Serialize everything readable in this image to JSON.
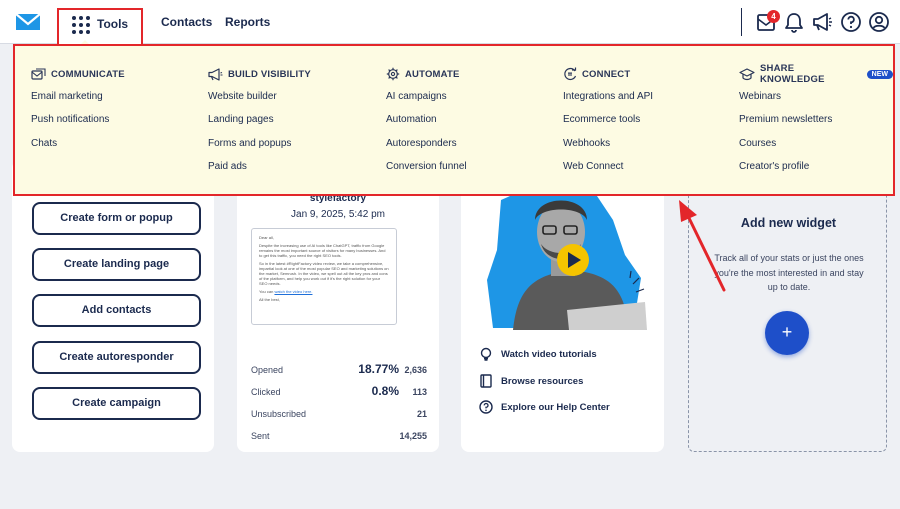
{
  "nav": {
    "tools_label": "Tools",
    "links": [
      "Contacts",
      "Reports"
    ],
    "notification_count": "4"
  },
  "icons": {
    "logo": "envelope-logo-icon",
    "tools": "grid-dots-icon",
    "inbox": "inbox-badge-icon",
    "bell": "bell-icon",
    "megaphone": "megaphone-icon",
    "help": "help-circle-icon",
    "account": "user-circle-icon"
  },
  "menu": {
    "columns": [
      {
        "title": "COMMUNICATE",
        "icon": "communicate-icon",
        "items": [
          "Email marketing",
          "Push notifications",
          "Chats"
        ]
      },
      {
        "title": "BUILD VISIBILITY",
        "icon": "megaphone-icon",
        "items": [
          "Website builder",
          "Landing pages",
          "Forms and popups",
          "Paid ads"
        ]
      },
      {
        "title": "AUTOMATE",
        "icon": "gear-icon",
        "items": [
          "AI campaigns",
          "Automation",
          "Autoresponders",
          "Conversion funnel"
        ]
      },
      {
        "title": "CONNECT",
        "icon": "connect-icon",
        "items": [
          "Integrations and API",
          "Ecommerce tools",
          "Webhooks",
          "Web Connect"
        ]
      },
      {
        "title": "SHARE KNOWLEDGE",
        "icon": "graduation-cap-icon",
        "badge": "NEW",
        "items": [
          "Webinars",
          "Premium newsletters",
          "Courses",
          "Creator's profile"
        ]
      }
    ]
  },
  "quick_actions": [
    "Create form or popup",
    "Create landing page",
    "Add contacts",
    "Create autoresponder",
    "Create campaign"
  ],
  "newsletter": {
    "name": "stylefactory",
    "date": "Jan 9, 2025, 5:42 pm",
    "preview": {
      "greeting": "Dear all,",
      "p1": "Despite the increasing use of AI tools like ChatGPT, traffic from Google remains the most important source of visitors for many businesses. And to get this traffic, you need the right SEO tools.",
      "p2": "So in the latest #RightFactory video review, we take a comprehensive, impartial look at one of the most popular SEO and marketing solutions on the market, Semrush. In the video, we spell out all the key pros and cons of the platform, and help you work out if it's the right solution for your SEO needs.",
      "cta_prefix": "You can",
      "cta_link": "watch the video here.",
      "signoff": "All the best,"
    },
    "stats": [
      {
        "label": "Opened",
        "percent": "18.77%",
        "value": "2,636"
      },
      {
        "label": "Clicked",
        "percent": "0.8%",
        "value": "113"
      },
      {
        "label": "Unsubscribed",
        "percent": "",
        "value": "21"
      },
      {
        "label": "Sent",
        "percent": "",
        "value": "14,255"
      }
    ]
  },
  "resources": {
    "links": [
      {
        "label": "Watch video tutorials",
        "icon": "lightbulb-icon"
      },
      {
        "label": "Browse resources",
        "icon": "book-icon"
      },
      {
        "label": "Explore our Help Center",
        "icon": "help-circle-icon"
      }
    ]
  },
  "widget": {
    "title": "Add new widget",
    "description": "Track all of your stats or just the ones you're the most interested in and stay up to date.",
    "add_label": "+"
  },
  "colors": {
    "primary": "#1e4fc9",
    "navy": "#1b2a4e",
    "highlight": "#e3262a",
    "menu_bg": "#fdfbe3",
    "accent": "#1e96e6",
    "play": "#f5c400"
  }
}
